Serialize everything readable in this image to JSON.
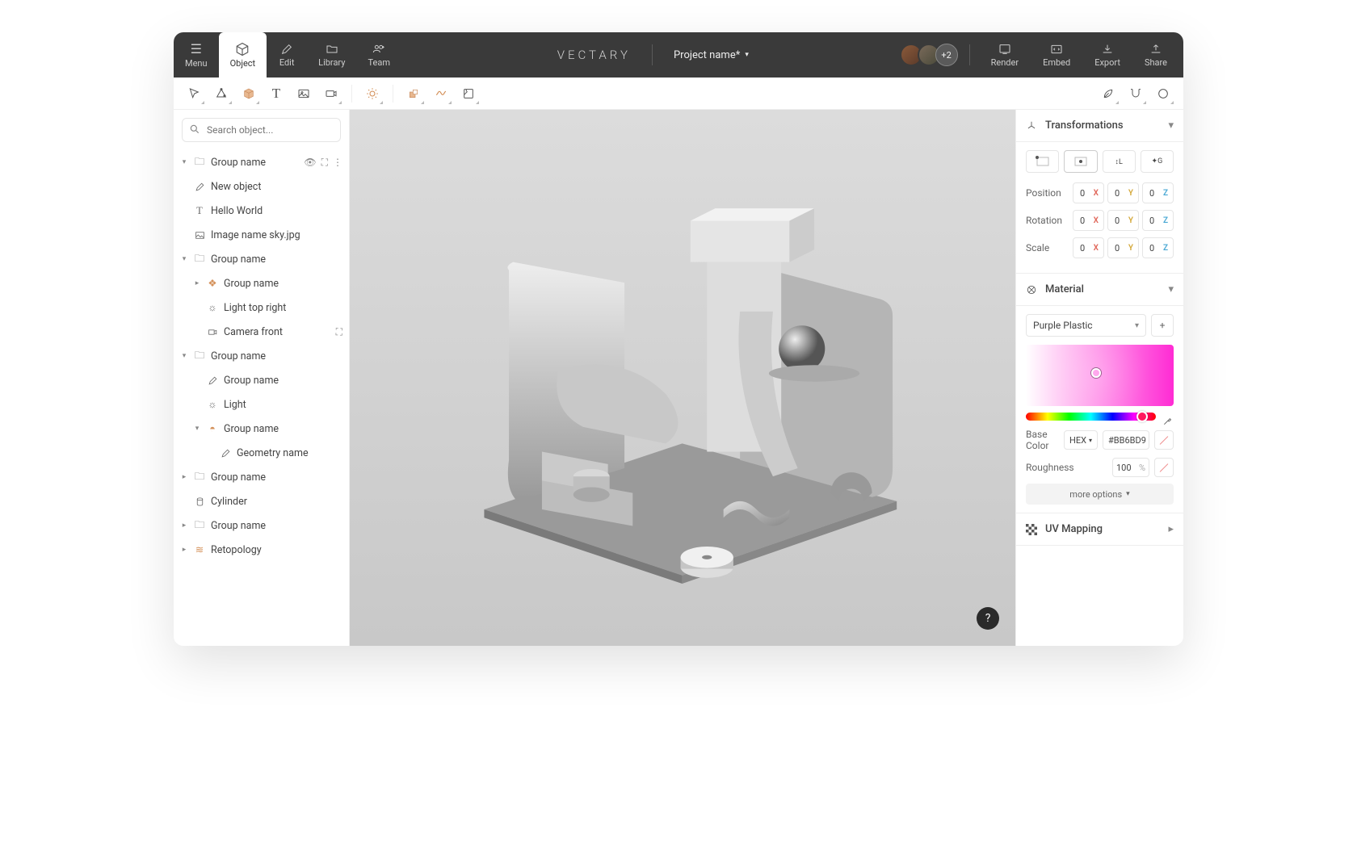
{
  "brand": "VECTARY",
  "project_name": "Project name*",
  "avatar_extra": "+2",
  "topbar": {
    "menu": "Menu",
    "object": "Object",
    "edit": "Edit",
    "library": "Library",
    "team": "Team",
    "render": "Render",
    "embed": "Embed",
    "export": "Export",
    "share": "Share"
  },
  "search": {
    "placeholder": "Search object..."
  },
  "tree": {
    "i0": "Group name",
    "i1": "New object",
    "i2": "Hello World",
    "i3": "Image name sky.jpg",
    "i4": "Group name",
    "i5": "Group name",
    "i6": "Light top right",
    "i7": "Camera front",
    "i8": "Group name",
    "i9": "Group name",
    "i10": "Light",
    "i11": "Group name",
    "i12": "Geometry name",
    "i13": "Group name",
    "i14": "Cylinder",
    "i15": "Group name",
    "i16": "Retopology"
  },
  "panels": {
    "transform": {
      "title": "Transformations",
      "position_label": "Position",
      "rotation_label": "Rotation",
      "scale_label": "Scale",
      "pos": {
        "x": "0",
        "y": "0",
        "z": "0"
      },
      "rot": {
        "x": "0",
        "y": "0",
        "z": "0"
      },
      "scl": {
        "x": "0",
        "y": "0",
        "z": "0"
      }
    },
    "material": {
      "title": "Material",
      "selected": "Purple Plastic",
      "basecolor_label": "Base Color",
      "color_mode": "HEX",
      "color_value": "#BB6BD9",
      "roughness_label": "Roughness",
      "roughness_value": "100",
      "more_options": "more options"
    },
    "uv": {
      "title": "UV Mapping"
    }
  },
  "help": "?"
}
